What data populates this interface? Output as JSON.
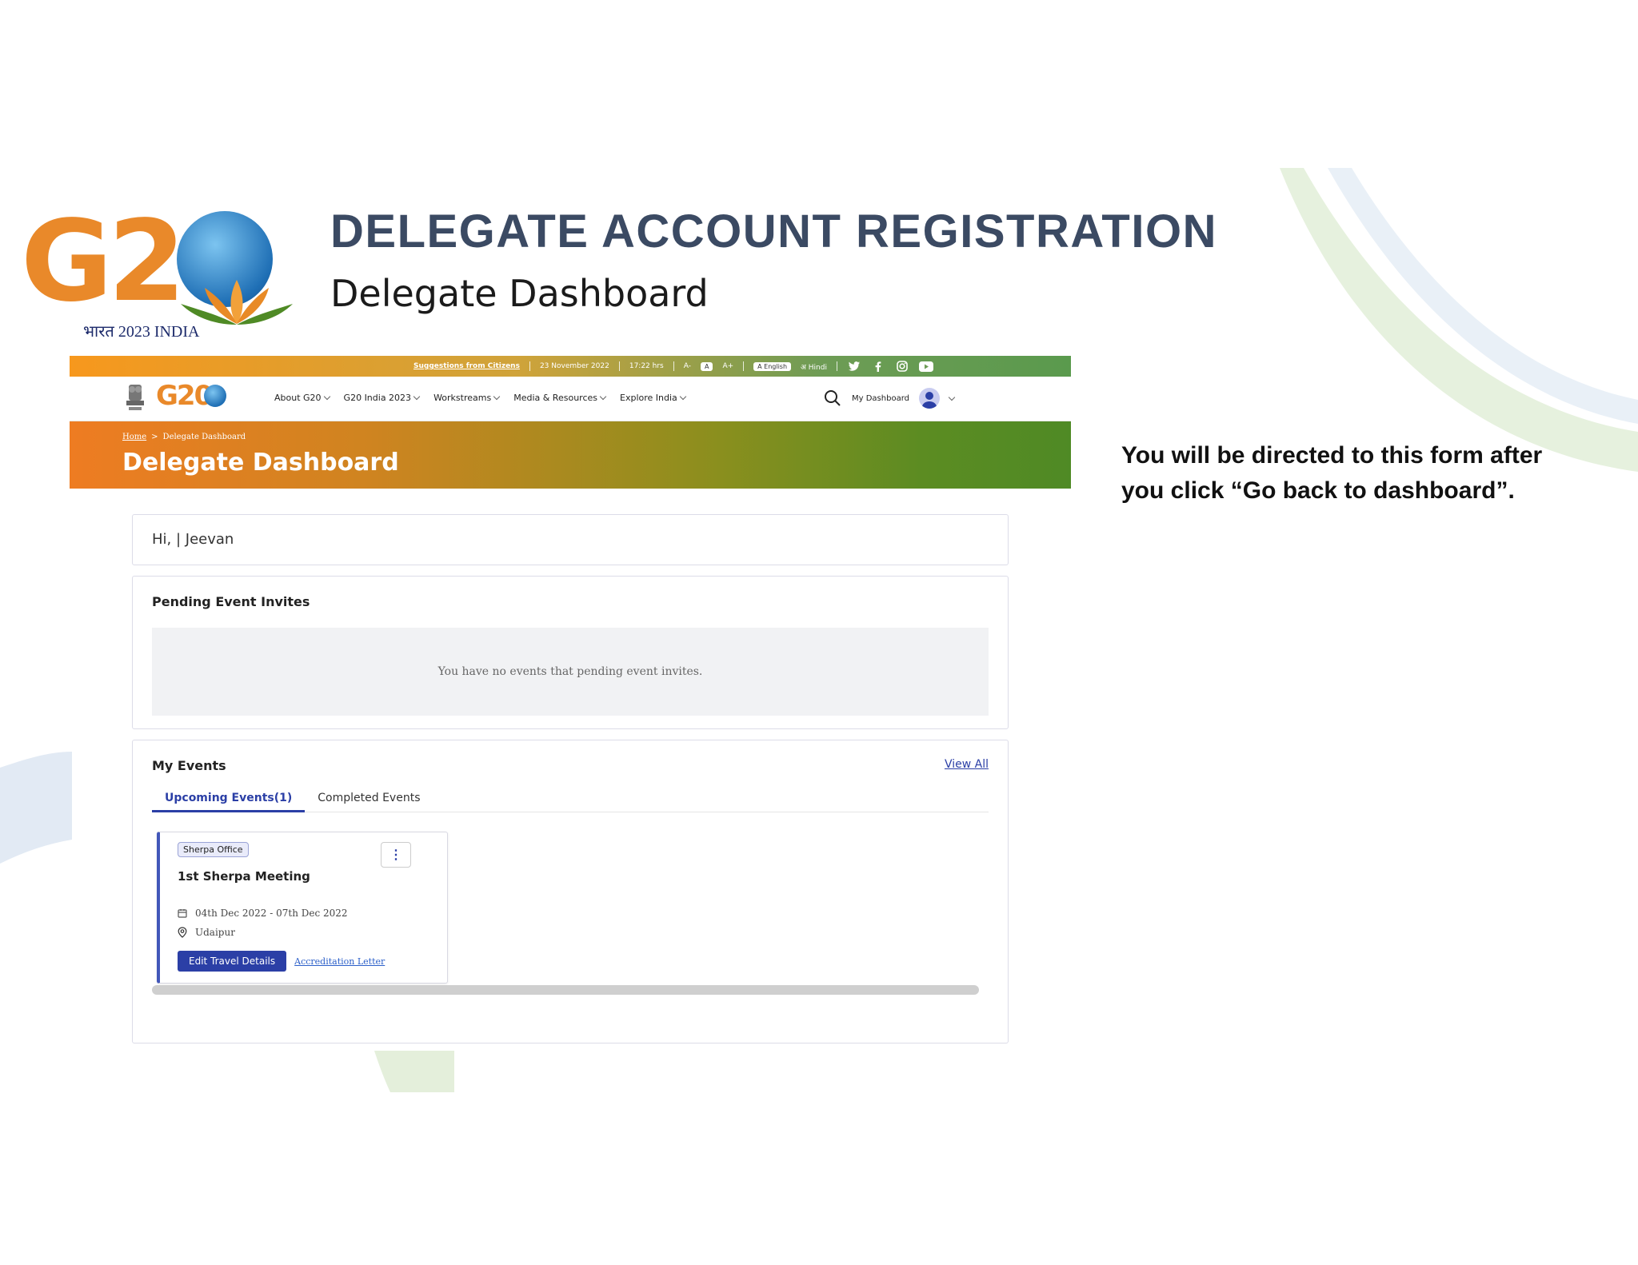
{
  "slide": {
    "title": "DELEGATE ACCOUNT REGISTRATION",
    "subtitle": "Delegate Dashboard",
    "note": "You will be directed to this form after you click “Go back to dashboard”.",
    "logo": {
      "text": "G20",
      "tagline": "भारत 2023 INDIA"
    }
  },
  "topbar": {
    "suggestions": "Suggestions from Citizens",
    "date": "23 November 2022",
    "time": "17:22 hrs",
    "font_small": "A-",
    "font_normal": "A",
    "font_large": "A+",
    "lang_english": "A English",
    "lang_hindi": "अ Hindi",
    "social_icons": [
      "twitter-icon",
      "facebook-icon",
      "instagram-icon",
      "youtube-icon"
    ]
  },
  "navbar": {
    "logo_text": "G20",
    "items": [
      {
        "label": "About G20"
      },
      {
        "label": "G20 India 2023"
      },
      {
        "label": "Workstreams"
      },
      {
        "label": "Media & Resources"
      },
      {
        "label": "Explore India"
      }
    ],
    "my_dashboard": "My Dashboard"
  },
  "banner": {
    "breadcrumb_home": "Home",
    "breadcrumb_sep": ">",
    "breadcrumb_current": "Delegate Dashboard",
    "title": "Delegate Dashboard"
  },
  "greeting": {
    "text": "Hi, | Jeevan"
  },
  "pending": {
    "heading": "Pending Event Invites",
    "empty_message": "You have no events that pending event invites."
  },
  "my_events": {
    "heading": "My Events",
    "view_all": "View All",
    "tabs": [
      {
        "label": "Upcoming Events(1)",
        "active": true
      },
      {
        "label": "Completed Events",
        "active": false
      }
    ],
    "events": [
      {
        "badge": "Sherpa Office",
        "title": "1st Sherpa Meeting",
        "dates": "04th Dec 2022 - 07th Dec 2022",
        "location": "Udaipur",
        "primary_action": "Edit Travel Details",
        "secondary_action": "Accreditation Letter"
      }
    ]
  },
  "colors": {
    "title": "#3b4a63",
    "accent_blue": "#2b3fa6",
    "saffron": "#ee7c22",
    "green": "#4f8a25"
  }
}
